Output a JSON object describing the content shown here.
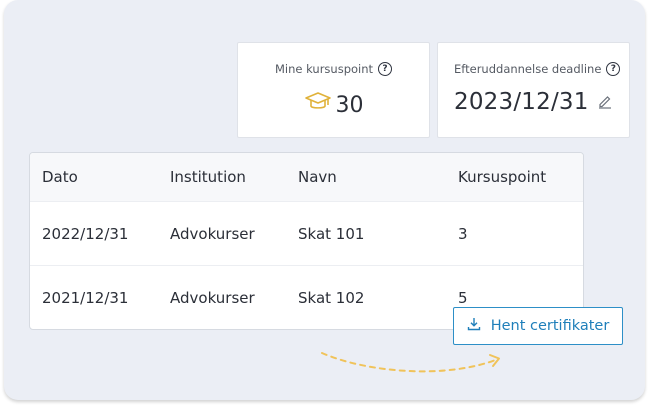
{
  "cards": {
    "points": {
      "label": "Mine kursuspoint",
      "value": "30",
      "icon": "graduation-cap-icon",
      "icon_color": "#e0b23a"
    },
    "deadline": {
      "label": "Efteruddannelse deadline",
      "value": "2023/12/31",
      "icon": "edit-pencil-icon"
    }
  },
  "table": {
    "headers": [
      "Dato",
      "Institution",
      "Navn",
      "Kursuspoint"
    ],
    "rows": [
      [
        "2022/12/31",
        "Advokurser",
        "Skat 101",
        "3"
      ],
      [
        "2021/12/31",
        "Advokurser",
        "Skat 102",
        "5"
      ]
    ]
  },
  "download_button": {
    "label": "Hent certifikater",
    "icon": "download-icon",
    "color": "#1f7fba"
  },
  "accent_arrow_color": "#f0c35a",
  "help_glyph": "?"
}
